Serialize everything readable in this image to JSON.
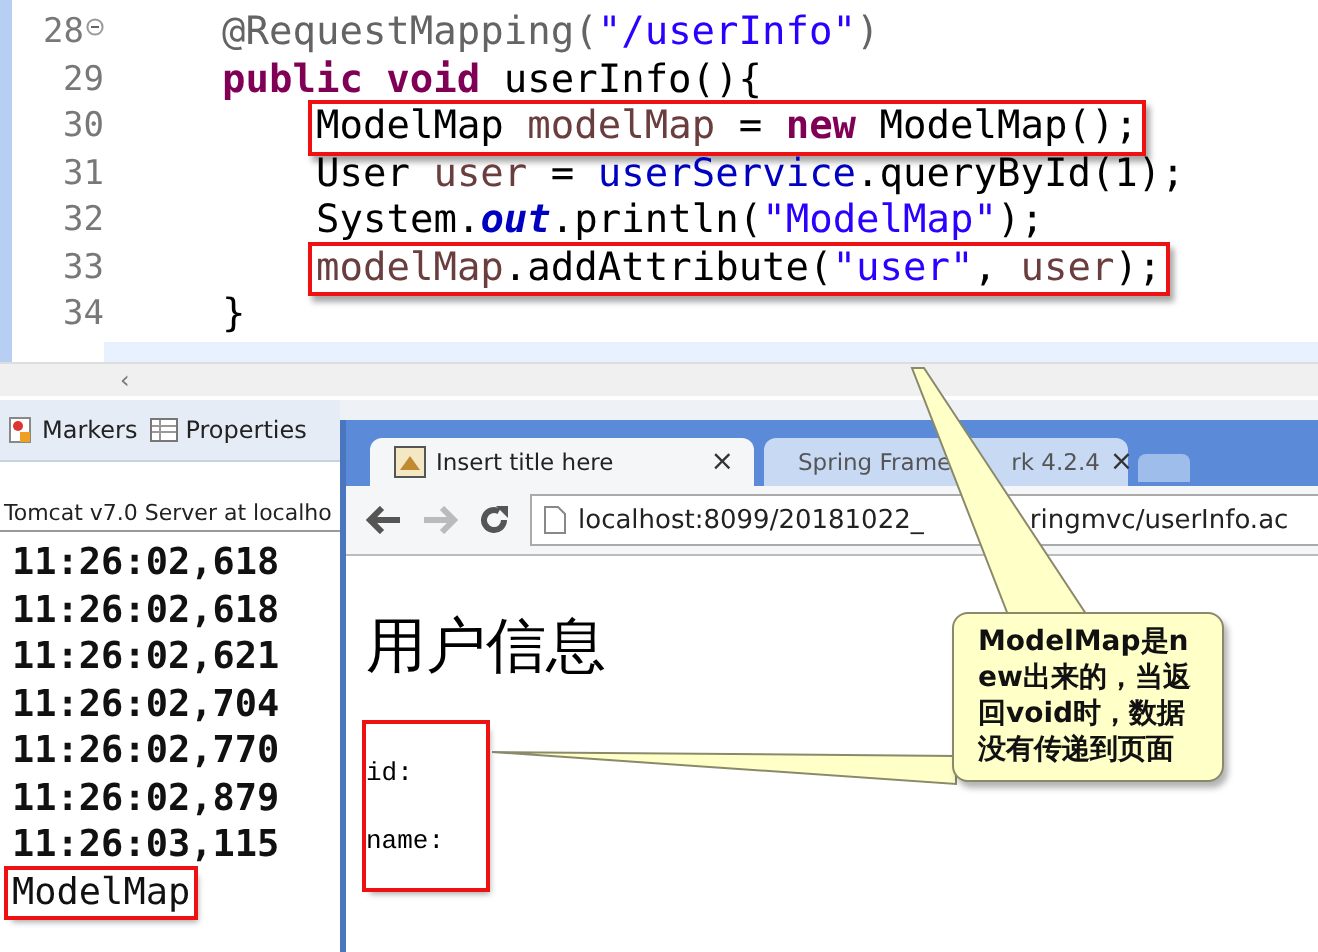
{
  "editor": {
    "lines": [
      {
        "number": "28",
        "fold": true,
        "kind": "member",
        "highlighted": false,
        "tokens": [
          {
            "text": "@RequestMapping(",
            "kind": "annotation"
          },
          {
            "text": "\"/userInfo\"",
            "kind": "string"
          },
          {
            "text": ")",
            "kind": "annotation"
          }
        ]
      },
      {
        "number": "29",
        "fold": false,
        "kind": "member",
        "highlighted": false,
        "tokens": [
          {
            "text": "public void",
            "kind": "keyword"
          },
          {
            "text": " userInfo(){",
            "kind": "plain"
          }
        ]
      },
      {
        "number": "30",
        "fold": false,
        "kind": "body",
        "highlighted": true,
        "tokens": [
          {
            "text": "ModelMap ",
            "kind": "plain"
          },
          {
            "text": "modelMap",
            "kind": "local"
          },
          {
            "text": " = ",
            "kind": "plain"
          },
          {
            "text": "new",
            "kind": "keyword"
          },
          {
            "text": " ModelMap();",
            "kind": "plain"
          }
        ]
      },
      {
        "number": "31",
        "fold": false,
        "kind": "body",
        "highlighted": false,
        "tokens": [
          {
            "text": "User ",
            "kind": "plain"
          },
          {
            "text": "user",
            "kind": "local"
          },
          {
            "text": " = ",
            "kind": "plain"
          },
          {
            "text": "userService",
            "kind": "field"
          },
          {
            "text": ".queryById(1);",
            "kind": "plain"
          }
        ]
      },
      {
        "number": "32",
        "fold": false,
        "kind": "body",
        "highlighted": false,
        "tokens": [
          {
            "text": "System.",
            "kind": "plain"
          },
          {
            "text": "out",
            "kind": "static"
          },
          {
            "text": ".println(",
            "kind": "plain"
          },
          {
            "text": "\"ModelMap\"",
            "kind": "string"
          },
          {
            "text": ");",
            "kind": "plain"
          }
        ]
      },
      {
        "number": "33",
        "fold": false,
        "kind": "body",
        "highlighted": true,
        "tokens": [
          {
            "text": "modelMap",
            "kind": "local"
          },
          {
            "text": ".addAttribute(",
            "kind": "plain"
          },
          {
            "text": "\"user\"",
            "kind": "string"
          },
          {
            "text": ", ",
            "kind": "plain"
          },
          {
            "text": "user",
            "kind": "local"
          },
          {
            "text": ");",
            "kind": "plain"
          }
        ]
      },
      {
        "number": "34",
        "fold": false,
        "kind": "member",
        "highlighted": false,
        "tokens": [
          {
            "text": "}",
            "kind": "plain"
          }
        ]
      }
    ],
    "scroll_left": "‹"
  },
  "panel": {
    "tabs": [
      {
        "label": "Markers",
        "kind": "markers"
      },
      {
        "label": "Properties",
        "kind": "properties"
      }
    ],
    "console_title": "Tomcat v7.0 Server at localho",
    "console_lines": [
      {
        "text": "11:26:02,618",
        "highlighted": false
      },
      {
        "text": "11:26:02,618",
        "highlighted": false
      },
      {
        "text": "11:26:02,621",
        "highlighted": false
      },
      {
        "text": "11:26:02,704",
        "highlighted": false
      },
      {
        "text": "11:26:02,770",
        "highlighted": false
      },
      {
        "text": "11:26:02,879",
        "highlighted": false
      },
      {
        "text": "11:26:03,115",
        "highlighted": false
      },
      {
        "text": "ModelMap",
        "highlighted": true
      }
    ]
  },
  "browser": {
    "tabs": [
      {
        "title_parts": [
          "Insert title here"
        ],
        "selected": true,
        "kind": "page",
        "close": "×"
      },
      {
        "title_parts": [
          "Spring Frame",
          "rk 4.2.4"
        ],
        "selected": false,
        "kind": "document",
        "close": "×"
      }
    ],
    "url_parts": [
      "localhost:8099/20181022_",
      "ringmvc/userInfo.ac"
    ],
    "heading": "用户信息",
    "fields": [
      {
        "text": "id:"
      },
      {
        "text": "name:"
      }
    ],
    "fields_highlighted": true
  },
  "callout": {
    "text": "ModelMap是new出来的，当返回void时，数据没有传递到页面"
  }
}
